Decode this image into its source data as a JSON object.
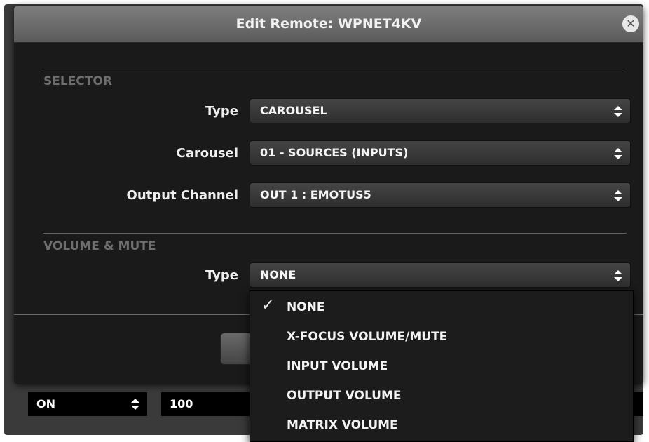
{
  "dialog": {
    "title": "Edit Remote: WPNET4KV",
    "close_icon": "close-circle-icon"
  },
  "selector": {
    "heading": "SELECTOR",
    "type_label": "Type",
    "type_value": "CAROUSEL",
    "carousel_label": "Carousel",
    "carousel_value": "01 - SOURCES (INPUTS)",
    "output_label": "Output Channel",
    "output_value": "OUT 1 : EMOTUS5"
  },
  "volume_mute": {
    "heading": "VOLUME & MUTE",
    "type_label": "Type",
    "type_value": "NONE"
  },
  "dropdown": {
    "options": [
      {
        "label": "NONE",
        "checked": true
      },
      {
        "label": "X-FOCUS VOLUME/MUTE",
        "checked": false
      },
      {
        "label": "INPUT VOLUME",
        "checked": false
      },
      {
        "label": "OUTPUT VOLUME",
        "checked": false
      },
      {
        "label": "MATRIX VOLUME",
        "checked": false
      }
    ],
    "check_glyph": "✓"
  },
  "background": {
    "led_mode_value": "ON",
    "brightness_value": "100"
  }
}
